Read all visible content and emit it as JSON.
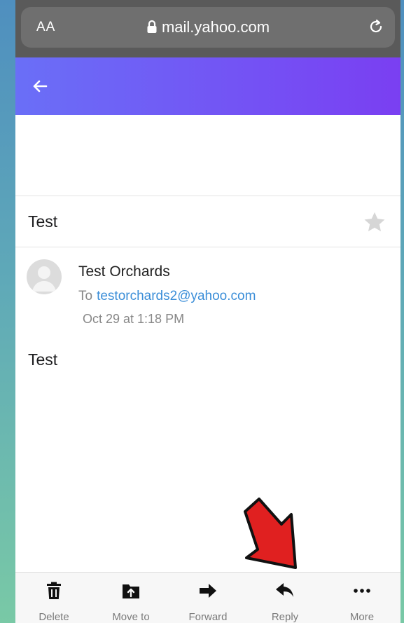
{
  "browser": {
    "text_size_label": "AA",
    "url": "mail.yahoo.com"
  },
  "email": {
    "subject": "Test",
    "sender_name": "Test Orchards",
    "to_prefix": "To",
    "to_address": "testorchards2@yahoo.com",
    "date": "Oct 29 at 1:18 PM",
    "body": "Test"
  },
  "toolbar": {
    "items": [
      {
        "label": "Delete",
        "icon": "trash-icon"
      },
      {
        "label": "Move to",
        "icon": "folder-move-icon"
      },
      {
        "label": "Forward",
        "icon": "forward-arrow-icon"
      },
      {
        "label": "Reply",
        "icon": "reply-arrow-icon"
      },
      {
        "label": "More",
        "icon": "more-dots-icon"
      }
    ]
  },
  "colors": {
    "header_start": "#6a6ff7",
    "header_end": "#7a3ff2",
    "link": "#3b8ed8",
    "annotation_arrow": "#e02020"
  }
}
